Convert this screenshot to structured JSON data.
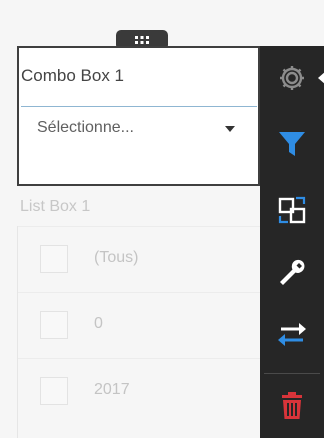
{
  "combo_box": {
    "title": "Combo Box 1",
    "select_value": "Sélectionne..."
  },
  "list_box": {
    "title": "List Box 1",
    "items": [
      {
        "label": "(Tous)"
      },
      {
        "label": "0"
      },
      {
        "label": "2017"
      }
    ]
  },
  "toolbar": {
    "tools": [
      {
        "icon": "gear-icon",
        "color": "#8c8c8c"
      },
      {
        "icon": "filter-icon",
        "color": "#2f8de4"
      },
      {
        "icon": "swap-boxes-icon",
        "color": "#ffffff"
      },
      {
        "icon": "wrench-icon",
        "color": "#ffffff"
      },
      {
        "icon": "arrows-exchange-icon",
        "color": "#2f8de4"
      },
      {
        "icon": "trash-icon",
        "color": "#d8343a"
      }
    ]
  },
  "colors": {
    "toolbar_bg": "#262626",
    "accent_blue": "#2f8de4",
    "delete_red": "#d8343a",
    "selection_border": "#3f3f3f"
  }
}
